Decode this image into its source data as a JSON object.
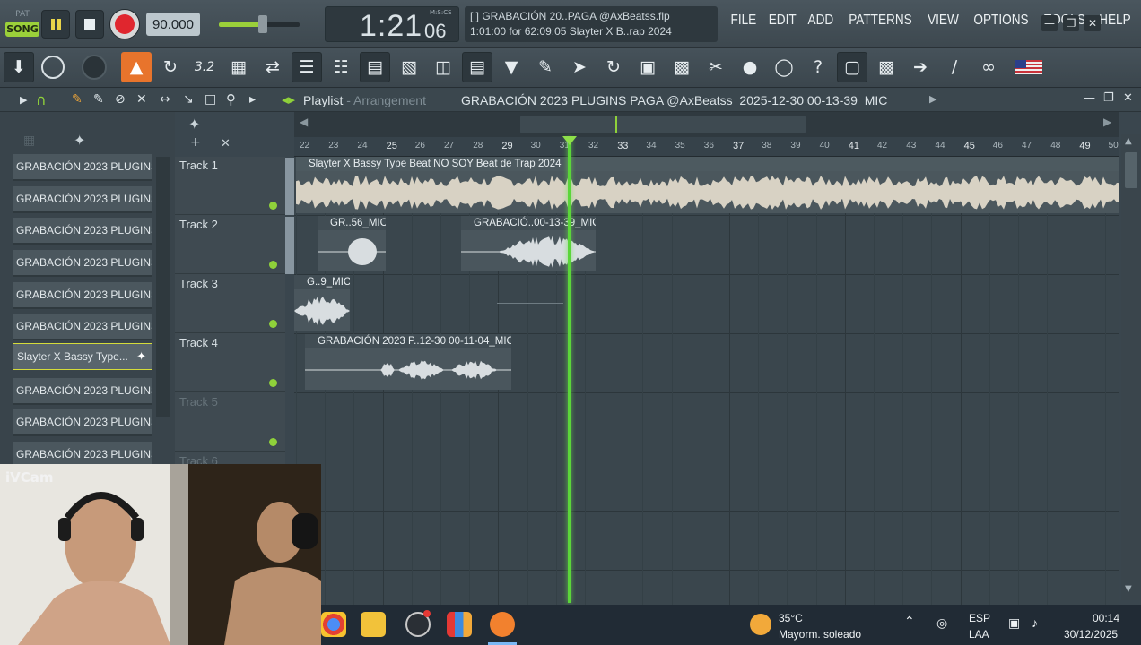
{
  "transport": {
    "pat_label": "PAT",
    "song_label": "SONG",
    "tempo": "90.000",
    "time_main": "1:21",
    "time_ticks": "06",
    "time_format": "M:S:CS"
  },
  "hint": {
    "line1": "[   ]  GRABACIÓN 20..PAGA @AxBeatss.flp",
    "line2": "1:01:00 for 62:09:05  Slayter X B..rap 2024"
  },
  "menu": [
    "FILE",
    "EDIT",
    "ADD",
    "PATTERNS",
    "VIEW",
    "OPTIONS",
    "TOOLS",
    "HELP"
  ],
  "window_controls": [
    "minimize",
    "restore",
    "close"
  ],
  "toolbar_icons": [
    "download-icon",
    "circle-icon",
    "knob-icon",
    "metronome-icon",
    "loop-record-icon",
    "typing-keyboard-icon",
    "step-edit-icon",
    "blend-icon",
    "playlist-icon",
    "mixer-icon",
    "channel-rack-icon",
    "piano-roll-icon",
    "browser-icon",
    "plugin-icon",
    "brush-icon",
    "render-icon",
    "undo-icon",
    "save-icon",
    "export-icon",
    "cut-icon",
    "mic-icon",
    "chat-icon",
    "help-icon",
    "window-icon",
    "piano-icon",
    "arrow-icon",
    "wand-icon",
    "link-icon",
    "flag-icon"
  ],
  "playlist": {
    "title": "Playlist",
    "subtitle": "Arrangement",
    "project": "GRABACIÓN 2023 PLUGINS PAGA @AxBeatss_2025-12-30 00-13-39_MIC"
  },
  "sidebar": {
    "items": [
      {
        "label": "GRABACIÓN 2023 PLUGINS..."
      },
      {
        "label": "GRABACIÓN 2023 PLUGINS..."
      },
      {
        "label": "GRABACIÓN 2023 PLUGINS..."
      },
      {
        "label": "GRABACIÓN 2023 PLUGINS..."
      },
      {
        "label": "GRABACIÓN 2023 PLUGINS..."
      },
      {
        "label": "GRABACIÓN 2023 PLUGINS..."
      },
      {
        "label": "Slayter X Bassy Type..."
      },
      {
        "label": "GRABACIÓN 2023 PLUGINS..."
      },
      {
        "label": "GRABACIÓN 2023 PLUGINS..."
      },
      {
        "label": "GRABACIÓN 2023 PLUGINS..."
      }
    ],
    "selected_index": 6
  },
  "tracks": [
    {
      "name": "Track 1"
    },
    {
      "name": "Track 2"
    },
    {
      "name": "Track 3"
    },
    {
      "name": "Track 4"
    },
    {
      "name": "Track 5"
    },
    {
      "name": "Track 6"
    }
  ],
  "ruler": [
    "22",
    "23",
    "24",
    "25",
    "26",
    "27",
    "28",
    "29",
    "30",
    "31",
    "32",
    "33",
    "34",
    "35",
    "36",
    "37",
    "38",
    "39",
    "40",
    "41",
    "42",
    "43",
    "44",
    "45",
    "46",
    "47",
    "48",
    "49",
    "50"
  ],
  "clips": {
    "clip1": "Slayter X Bassy Type Beat  NO SOY  Beat de Trap 2024",
    "clip2a": "GR..56_MIC",
    "clip2b": "GRABACIÓ..00-13-39_MIC",
    "clip3": "G..9_MIC",
    "clip4": "GRABACIÓN 2023 P..12-30 00-11-04_MIC"
  },
  "webcam": {
    "label": "iVCam"
  },
  "taskbar": {
    "temperature": "35°C",
    "weather": "Mayorm. soleado",
    "lang1": "ESP",
    "lang2": "LAA",
    "time": "00:14",
    "date": "30/12/2025"
  },
  "colors": {
    "accent_green": "#9bd03a",
    "playhead": "#5bd63a",
    "record": "#e0262e",
    "active_tool": "#e8742c"
  }
}
